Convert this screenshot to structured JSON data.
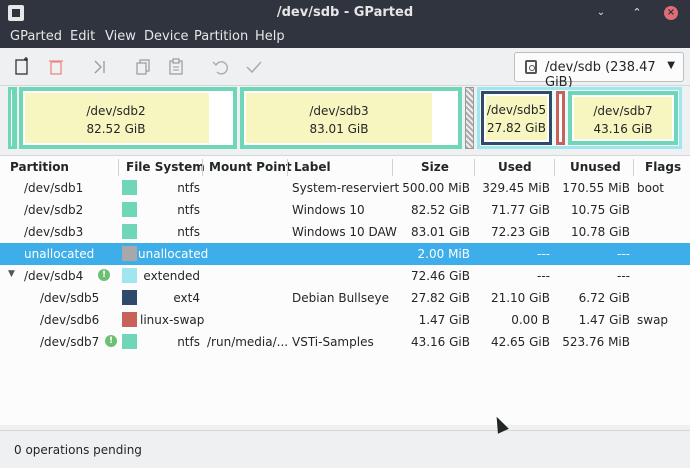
{
  "window": {
    "title": "/dev/sdb - GParted"
  },
  "menu": [
    "GParted",
    "Edit",
    "View",
    "Device",
    "Partition",
    "Help"
  ],
  "toolbar": {
    "buttons": [
      "new-partition-icon",
      "delete-icon",
      "resize-move-icon",
      "copy-icon",
      "paste-icon",
      "undo-icon",
      "apply-icon"
    ],
    "device": "/dev/sdb (238.47 GiB)"
  },
  "diskmap": [
    {
      "name": "/dev/sdb2",
      "size": "82.52 GiB"
    },
    {
      "name": "/dev/sdb3",
      "size": "83.01 GiB"
    },
    {
      "name": "/dev/sdb5",
      "size": "27.82 GiB"
    },
    {
      "name": "/dev/sdb7",
      "size": "43.16 GiB"
    }
  ],
  "columns": [
    "Partition",
    "File System",
    "Mount Point",
    "Label",
    "Size",
    "Used",
    "Unused",
    "Flags"
  ],
  "rows": [
    {
      "partition": "/dev/sdb1",
      "fs": "ntfs",
      "mount": "",
      "label": "System-reserviert",
      "size": "500.00 MiB",
      "used": "329.45 MiB",
      "unused": "170.55 MiB",
      "flags": "boot",
      "color": "#6fd6b8"
    },
    {
      "partition": "/dev/sdb2",
      "fs": "ntfs",
      "mount": "",
      "label": "Windows 10",
      "size": "82.52 GiB",
      "used": "71.77 GiB",
      "unused": "10.75 GiB",
      "flags": "",
      "color": "#6fd6b8"
    },
    {
      "partition": "/dev/sdb3",
      "fs": "ntfs",
      "mount": "",
      "label": "Windows 10 DAW",
      "size": "83.01 GiB",
      "used": "72.23 GiB",
      "unused": "10.78 GiB",
      "flags": "",
      "color": "#6fd6b8"
    },
    {
      "partition": "unallocated",
      "fs": "unallocated",
      "mount": "",
      "label": "",
      "size": "2.00 MiB",
      "used": "---",
      "unused": "---",
      "flags": "",
      "color": "#a8a8a8"
    },
    {
      "partition": "/dev/sdb4",
      "fs": "extended",
      "mount": "",
      "label": "",
      "size": "72.46 GiB",
      "used": "---",
      "unused": "---",
      "flags": "",
      "color": "#9fe6ee"
    },
    {
      "partition": "/dev/sdb5",
      "fs": "ext4",
      "mount": "",
      "label": "Debian Bullseye",
      "size": "27.82 GiB",
      "used": "21.10 GiB",
      "unused": "6.72 GiB",
      "flags": "",
      "color": "#2f4a6a"
    },
    {
      "partition": "/dev/sdb6",
      "fs": "linux-swap",
      "mount": "",
      "label": "",
      "size": "1.47 GiB",
      "used": "0.00 B",
      "unused": "1.47 GiB",
      "flags": "swap",
      "color": "#c8615a"
    },
    {
      "partition": "/dev/sdb7",
      "fs": "ntfs",
      "mount": "/run/media/...",
      "label": "VSTi-Samples",
      "size": "43.16 GiB",
      "used": "42.65 GiB",
      "unused": "523.76 MiB",
      "flags": "",
      "color": "#6fd6b8"
    }
  ],
  "status": "0 operations pending",
  "colors": {
    "accent": "#3daee9",
    "ntfs": "#6fd6b8",
    "ext4": "#2f4a6a",
    "swap": "#c8615a",
    "extended": "#9fe6ee",
    "unallocated": "#a8a8a8",
    "used_fill": "#f8f6c0"
  }
}
